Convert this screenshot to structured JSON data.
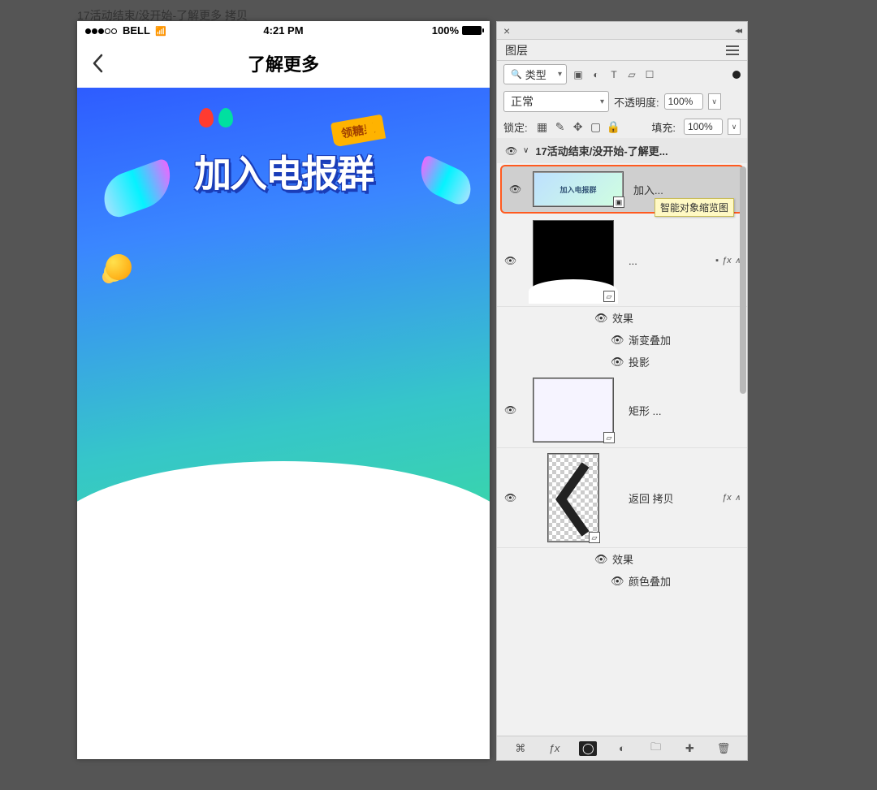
{
  "document": {
    "title": "17活动结束/没开始-了解更多 拷贝"
  },
  "statusbar": {
    "carrier": "BELL",
    "time": "4:21 PM",
    "battery": "100%"
  },
  "header": {
    "title": "了解更多"
  },
  "hero": {
    "banner_title": "加入电报群",
    "flag_text": "领糖果"
  },
  "panel": {
    "tab": "图层",
    "filter_label": "类型",
    "blend_mode": "正常",
    "opacity_label": "不透明度:",
    "opacity_value": "100%",
    "lock_label": "锁定:",
    "fill_label": "填充:",
    "fill_value": "100%",
    "group_name": "17活动结束/没开始-了解更...",
    "layers": [
      {
        "name": "加入..."
      },
      {
        "name": "...",
        "fx": true
      },
      {
        "name": "矩形 ..."
      },
      {
        "name": "返回 拷贝",
        "fx": true
      }
    ],
    "effects_label": "效果",
    "gradient_overlay": "渐变叠加",
    "drop_shadow": "投影",
    "color_overlay": "颜色叠加",
    "tooltip": "智能对象缩览图"
  }
}
